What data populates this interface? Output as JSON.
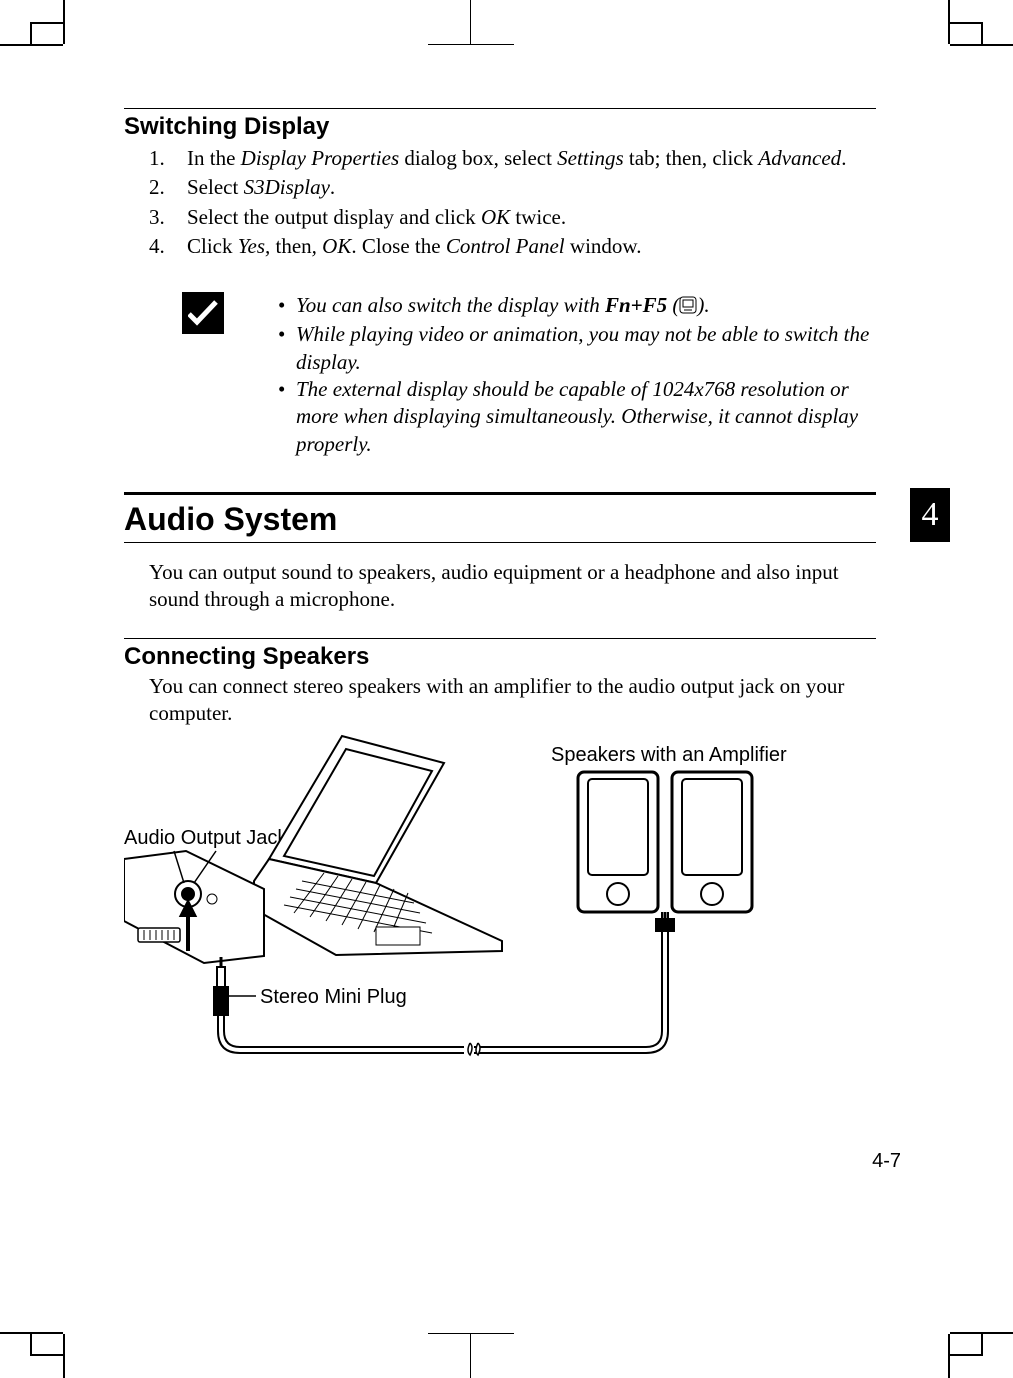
{
  "section1": {
    "heading": "Switching Display",
    "steps": [
      {
        "num": "1.",
        "parts": [
          "In the ",
          "Display Properties",
          " dialog box, select ",
          "Settings",
          " tab; then, click ",
          "Advanced",
          "."
        ]
      },
      {
        "num": "2.",
        "parts": [
          "Select ",
          "S3Display",
          "."
        ]
      },
      {
        "num": "3.",
        "parts": [
          "Select the output display and click ",
          "OK",
          " twice."
        ]
      },
      {
        "num": "4.",
        "parts": [
          "Click ",
          "Yes, ",
          "then",
          ", OK",
          ". Close the ",
          "Control Panel",
          " window."
        ]
      }
    ]
  },
  "notes": {
    "items": [
      " You can also switch the display with Fn+F5 (   ).",
      "While playing video or animation, you may not be able to switch the display.",
      "The external display should be capable of 1024x768 resolution or more when displaying simultaneously. Otherwise, it cannot display properly."
    ],
    "note1_pre": " You can also switch the display with ",
    "note1_key": "Fn+F5",
    "note1_post": " (",
    "note1_end": ").",
    "note2": "While playing video or animation, you may not be able to switch the display.",
    "note3": "The external display should be capable of 1024x768 resolution or more when displaying simultaneously. Otherwise, it cannot display properly."
  },
  "section2": {
    "heading": "Audio System",
    "intro": "You can output sound to speakers, audio equipment or a headphone and also input sound through a microphone."
  },
  "section3": {
    "heading": "Connecting Speakers",
    "intro": "You can connect stereo speakers with an amplifier to the audio output jack on your computer."
  },
  "diagram": {
    "label_speakers": "Speakers with an Amplifier",
    "label_jack": "Audio Output Jack",
    "label_plug": "Stereo Mini Plug"
  },
  "chapter_tab": "4",
  "page_number": "4-7"
}
